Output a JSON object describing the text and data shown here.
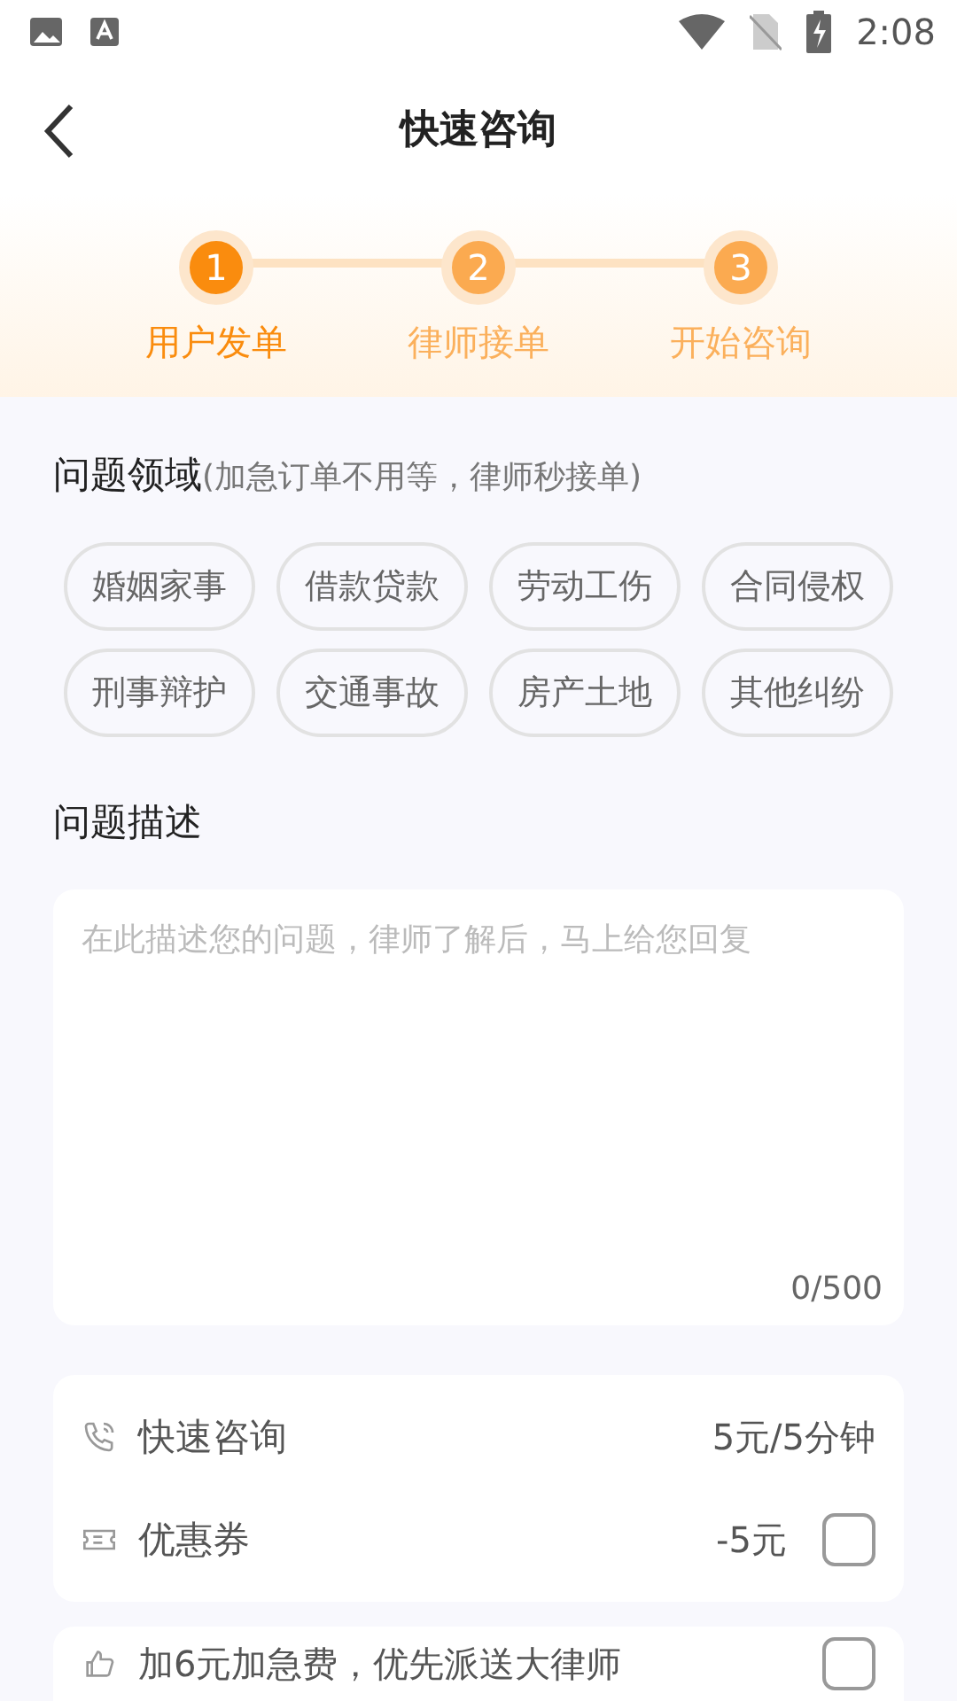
{
  "status_bar": {
    "time": "2:08"
  },
  "header": {
    "title": "快速咨询"
  },
  "steps": [
    {
      "number": "1",
      "label": "用户发单",
      "selected": true
    },
    {
      "number": "2",
      "label": "律师接单",
      "selected": false
    },
    {
      "number": "3",
      "label": "开始咨询",
      "selected": false
    }
  ],
  "domain": {
    "title": "问题领域",
    "hint": "(加急订单不用等，律师秒接单)"
  },
  "categories": [
    {
      "label": "婚姻家事",
      "selected": false
    },
    {
      "label": "借款贷款",
      "selected": false
    },
    {
      "label": "劳动工伤",
      "selected": false
    },
    {
      "label": "合同侵权",
      "selected": false
    },
    {
      "label": "刑事辩护",
      "selected": false
    },
    {
      "label": "交通事故",
      "selected": false
    },
    {
      "label": "房产土地",
      "selected": false
    },
    {
      "label": "其他纠纷",
      "selected": false
    }
  ],
  "description": {
    "title": "问题描述",
    "placeholder": "在此描述您的问题，律师了解后，马上给您回复",
    "counter": "0/500"
  },
  "price_items": [
    {
      "kind": "phone",
      "label": "快速咨询",
      "value": "5元/5分钟"
    },
    {
      "kind": "coupon",
      "label": "优惠券",
      "value": "-5元",
      "checked": false
    }
  ],
  "urgent": {
    "label": "加6元加急费，优先派送大律师",
    "checked": false
  }
}
